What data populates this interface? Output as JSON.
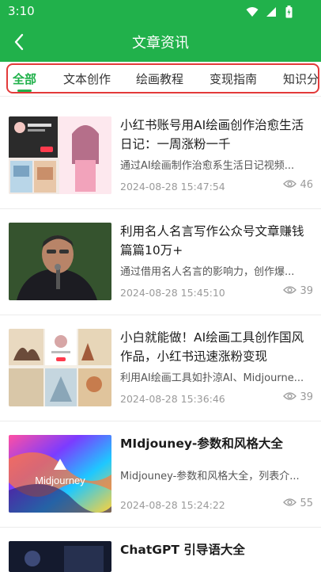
{
  "status": {
    "time": "3:10"
  },
  "header": {
    "title": "文章资讯"
  },
  "tabs": [
    {
      "label": "全部",
      "active": true
    },
    {
      "label": "文本创作",
      "active": false
    },
    {
      "label": "绘画教程",
      "active": false
    },
    {
      "label": "变现指南",
      "active": false
    },
    {
      "label": "知识分享",
      "active": false
    }
  ],
  "articles": [
    {
      "title": "小红书账号用AI绘画创作治愈生活日记：一周涨粉一千",
      "summary": "通过AI绘画制作治愈系生活日记视频...",
      "date": "2024-08-28 15:47:54",
      "views": "46"
    },
    {
      "title": "利用名人名言写作公众号文章赚钱篇篇10万+",
      "summary": "通过借用名人名言的影响力，创作爆...",
      "date": "2024-08-28 15:45:10",
      "views": "39"
    },
    {
      "title": "小白就能做！AI绘画工具创作国风作品，小红书迅速涨粉变现",
      "summary": "利用AI绘画工具如扑涼AI、Midjourne...",
      "date": "2024-08-28 15:36:46",
      "views": "39"
    },
    {
      "title": "MIdjouney-参数和风格大全",
      "summary": "Midjouney-参数和风格大全，列表介...",
      "date": "2024-08-28 15:24:22",
      "views": "55",
      "thumb_text": "Midjourney"
    },
    {
      "title": "ChatGPT 引导语大全",
      "summary": "",
      "date": "",
      "views": ""
    }
  ],
  "colors": {
    "brand_green": "#21b14b",
    "highlight_red": "#e33a3a"
  },
  "icons": [
    "back-arrow-icon",
    "wifi-icon",
    "signal-icon",
    "battery-icon",
    "eye-icon"
  ]
}
